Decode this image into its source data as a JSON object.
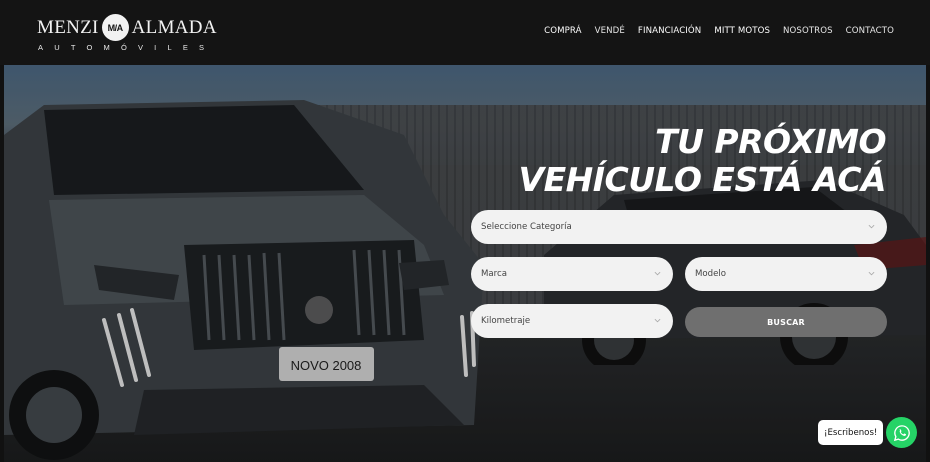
{
  "brand": {
    "word_left": "MENZI",
    "mark": "M/A",
    "word_right": "ALMADA",
    "subtitle": "AUTOMÓVILES"
  },
  "nav": {
    "items": [
      {
        "label": "COMPRÁ"
      },
      {
        "label": "VENDÉ"
      },
      {
        "label": "FINANCIACIÓN"
      },
      {
        "label": "MITT MOTOS"
      },
      {
        "label": "NOSOTROS"
      },
      {
        "label": "CONTACTO"
      }
    ]
  },
  "hero": {
    "headline_line1": "TU PRÓXIMO",
    "headline_line2": "VEHÍCULO ESTÁ ACÁ",
    "plate_text": "NOVO 2008"
  },
  "search": {
    "category_label": "Seleccione Categoría",
    "brand_label": "Marca",
    "model_label": "Modelo",
    "mileage_label": "Kilometraje",
    "button_label": "BUSCAR"
  },
  "chat": {
    "bubble_text": "¡Escribenos!",
    "icon": "whatsapp-icon",
    "color": "#25d366"
  }
}
